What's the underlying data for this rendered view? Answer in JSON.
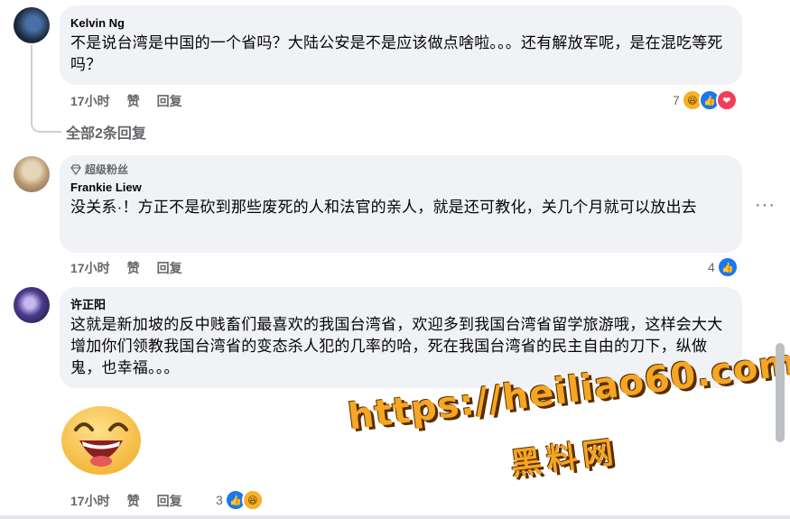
{
  "comments": [
    {
      "author": "Kelvin Ng",
      "text": "不是说台湾是中国的一个省吗？大陆公安是不是应该做点啥啦。。。还有解放军呢，是在混吃等死吗？",
      "time": "17小时",
      "like_label": "赞",
      "reply_label": "回复",
      "reaction_count": "7",
      "reactions": [
        "haha-icon",
        "like-icon",
        "love-icon"
      ],
      "replies_link": "全部2条回复"
    },
    {
      "badge": "超级粉丝",
      "author": "Frankie Liew",
      "text": "没关系·！方正不是砍到那些废死的人和法官的亲人，就是还可教化，关几个月就可以放出去",
      "time": "17小时",
      "like_label": "赞",
      "reply_label": "回复",
      "reaction_count": "4",
      "reactions": [
        "like-icon"
      ]
    },
    {
      "author": "许正阳",
      "text": "这就是新加坡的反中贱畜们最喜欢的我国台湾省，欢迎多到我国台湾省留学旅游哦，这样会大大增加你们领教我国台湾省的变态杀人犯的几率的哈，死在我国台湾省的民主自由的刀下，纵做鬼，也幸福。。。",
      "time": "17小时",
      "like_label": "赞",
      "reply_label": "回复",
      "reaction_count": "3",
      "reactions": [
        "like-icon",
        "haha-icon"
      ]
    }
  ],
  "more_options": "···",
  "watermark": {
    "url": "https://heiliao60.com",
    "title": "黑料网"
  },
  "colors": {
    "bubble": "#f0f2f5",
    "meta_text": "#65676b",
    "like": "#1877f2",
    "haha": "#f7b125",
    "love": "#f33e58",
    "watermark": "#f5a623"
  }
}
